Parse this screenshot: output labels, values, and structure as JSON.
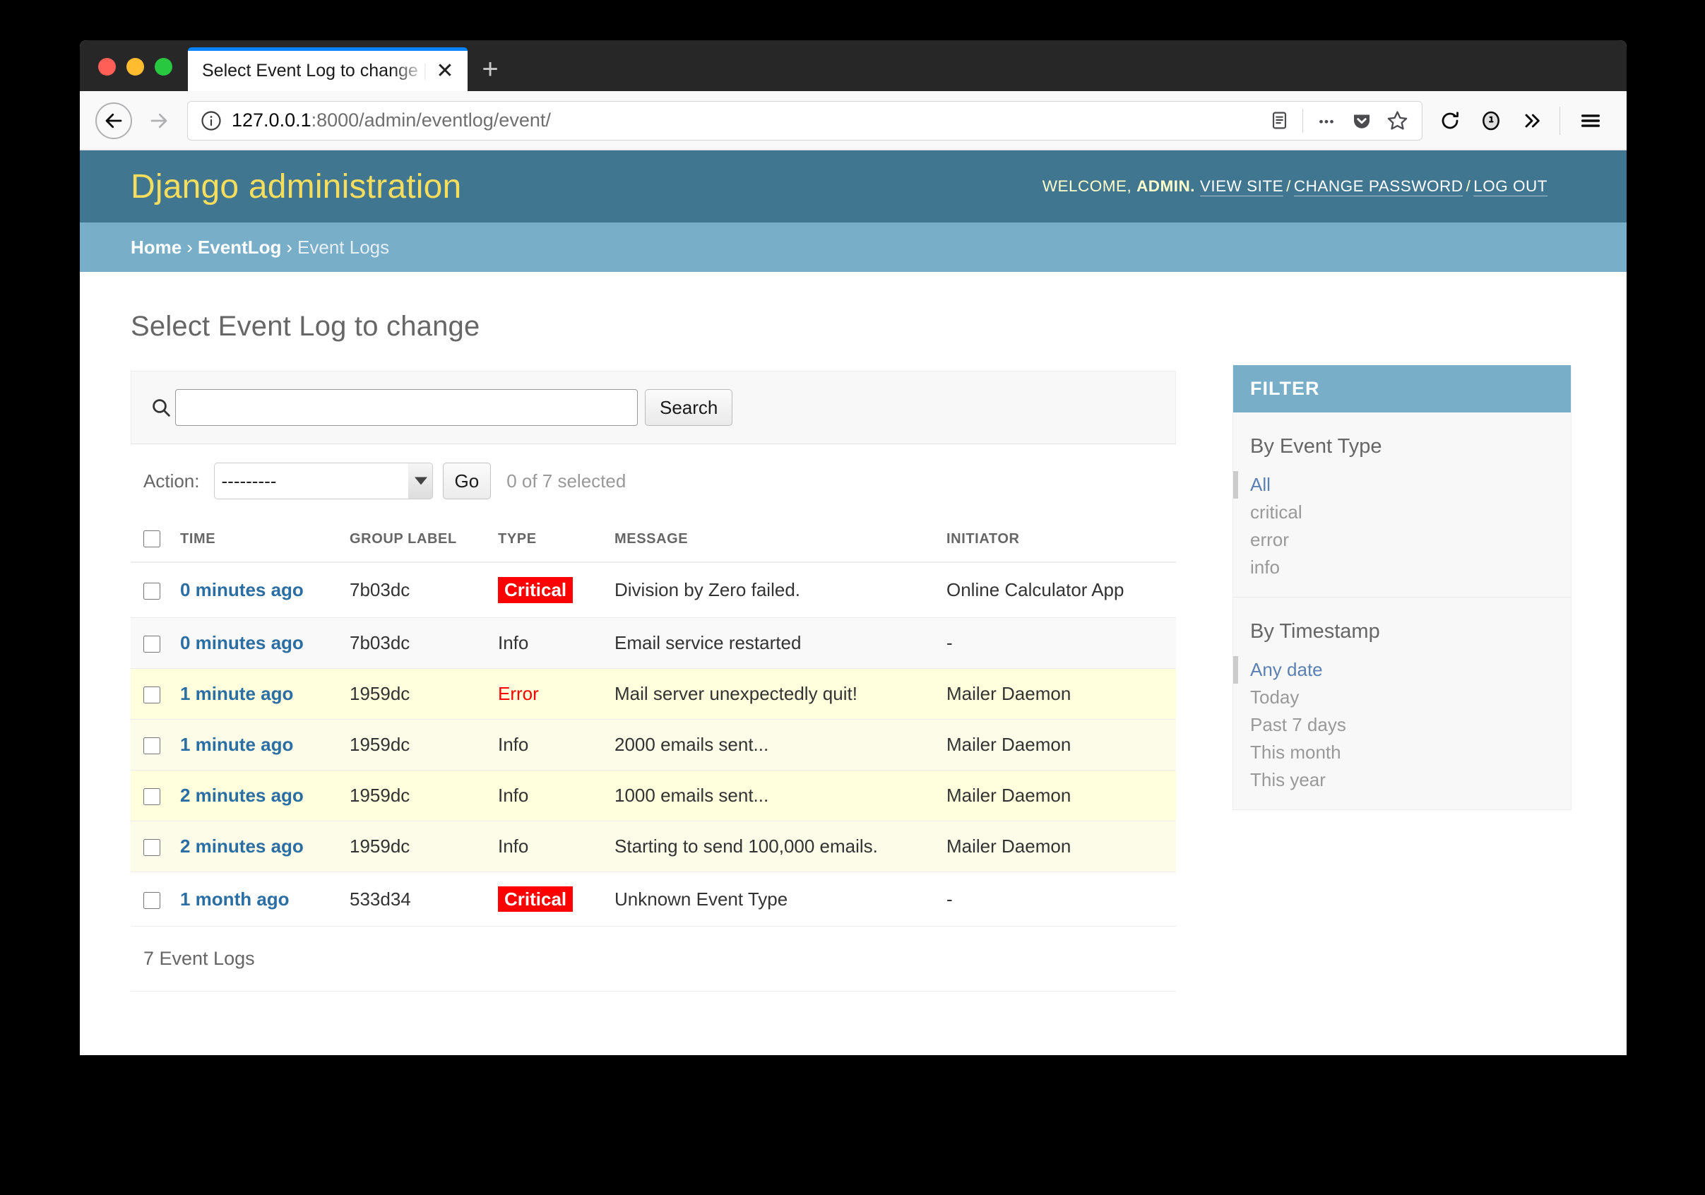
{
  "browser": {
    "tab_title": "Select Event Log to change | Django",
    "tab_close_glyph": "✕",
    "new_tab_glyph": "+",
    "url_host": "127.0.0.1",
    "url_path": ":8000/admin/eventlog/event/"
  },
  "header": {
    "site_name": "Django administration",
    "welcome_prefix": "WELCOME,",
    "admin_name": "ADMIN.",
    "view_site": "VIEW SITE",
    "change_password": "CHANGE PASSWORD",
    "log_out": "LOG OUT",
    "separator": "/"
  },
  "breadcrumbs": {
    "home": "Home",
    "app": "EventLog",
    "current": "Event Logs",
    "separator": "›"
  },
  "main": {
    "page_title": "Select Event Log to change",
    "search": {
      "value": "",
      "placeholder": "",
      "submit_label": "Search"
    },
    "actions": {
      "label": "Action:",
      "selected_option": "---------",
      "options": [
        "---------"
      ],
      "go_label": "Go",
      "counter": "0 of 7 selected"
    },
    "table": {
      "columns": [
        "TIME",
        "GROUP LABEL",
        "TYPE",
        "MESSAGE",
        "INITIATOR"
      ],
      "rows": [
        {
          "time": "0 minutes ago",
          "group_label": "7b03dc",
          "type": "Critical",
          "type_style": "badge",
          "message": "Division by Zero failed.",
          "initiator": "Online Calculator App",
          "row_style": "row1",
          "checked": false
        },
        {
          "time": "0 minutes ago",
          "group_label": "7b03dc",
          "type": "Info",
          "type_style": "plain",
          "message": "Email service restarted",
          "initiator": "-",
          "row_style": "row2",
          "checked": false
        },
        {
          "time": "1 minute ago",
          "group_label": "1959dc",
          "type": "Error",
          "type_style": "error",
          "message": "Mail server unexpectedly quit!",
          "initiator": "Mailer Daemon",
          "row_style": "hl1",
          "checked": false
        },
        {
          "time": "1 minute ago",
          "group_label": "1959dc",
          "type": "Info",
          "type_style": "plain",
          "message": "2000 emails sent...",
          "initiator": "Mailer Daemon",
          "row_style": "hl2",
          "checked": false
        },
        {
          "time": "2 minutes ago",
          "group_label": "1959dc",
          "type": "Info",
          "type_style": "plain",
          "message": "1000 emails sent...",
          "initiator": "Mailer Daemon",
          "row_style": "hl1",
          "checked": false
        },
        {
          "time": "2 minutes ago",
          "group_label": "1959dc",
          "type": "Info",
          "type_style": "plain",
          "message": "Starting to send 100,000 emails.",
          "initiator": "Mailer Daemon",
          "row_style": "hl2",
          "checked": false
        },
        {
          "time": "1 month ago",
          "group_label": "533d34",
          "type": "Critical",
          "type_style": "badge",
          "message": "Unknown Event Type",
          "initiator": "-",
          "row_style": "row1",
          "checked": false
        }
      ]
    },
    "result_count": "7 Event Logs"
  },
  "filter": {
    "header": "FILTER",
    "groups": [
      {
        "title": "By Event Type",
        "options": [
          {
            "label": "All",
            "selected": true
          },
          {
            "label": "critical",
            "selected": false
          },
          {
            "label": "error",
            "selected": false
          },
          {
            "label": "info",
            "selected": false
          }
        ]
      },
      {
        "title": "By Timestamp",
        "options": [
          {
            "label": "Any date",
            "selected": true
          },
          {
            "label": "Today",
            "selected": false
          },
          {
            "label": "Past 7 days",
            "selected": false
          },
          {
            "label": "This month",
            "selected": false
          },
          {
            "label": "This year",
            "selected": false
          }
        ]
      }
    ]
  },
  "colors": {
    "django_header": "#417690",
    "breadcrumb_bar": "#79aec8",
    "site_name_text": "#f5dd5d",
    "critical_badge": "#ff0000",
    "error_text": "#ff0000",
    "link_blue": "#2b6ea3",
    "highlight_row": "#ffffdd"
  }
}
